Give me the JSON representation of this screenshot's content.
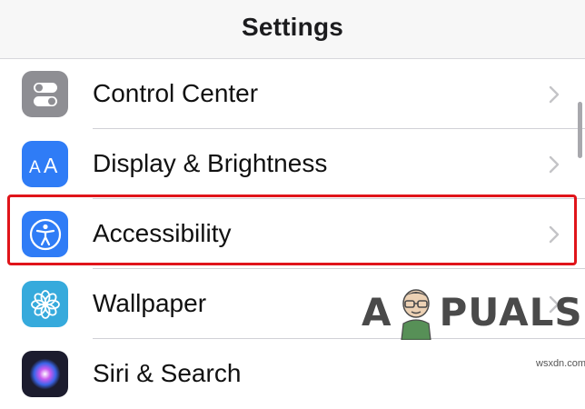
{
  "header": {
    "title": "Settings"
  },
  "rows": [
    {
      "label": "Control Center",
      "icon": "toggle-switches-icon",
      "color": "#8e8e93"
    },
    {
      "label": "Display & Brightness",
      "icon": "text-size-aa-icon",
      "color": "#2f7cf6"
    },
    {
      "label": "Accessibility",
      "icon": "accessibility-person-icon",
      "color": "#2f7cf6"
    },
    {
      "label": "Wallpaper",
      "icon": "flower-icon",
      "color": "#36aadc"
    },
    {
      "label": "Siri & Search",
      "icon": "siri-icon",
      "color": "#1c1c2e"
    }
  ],
  "highlight_color": "#e0141a",
  "watermark": {
    "first": "A",
    "rest": "PUALS",
    "site": "wsxdn.com"
  }
}
